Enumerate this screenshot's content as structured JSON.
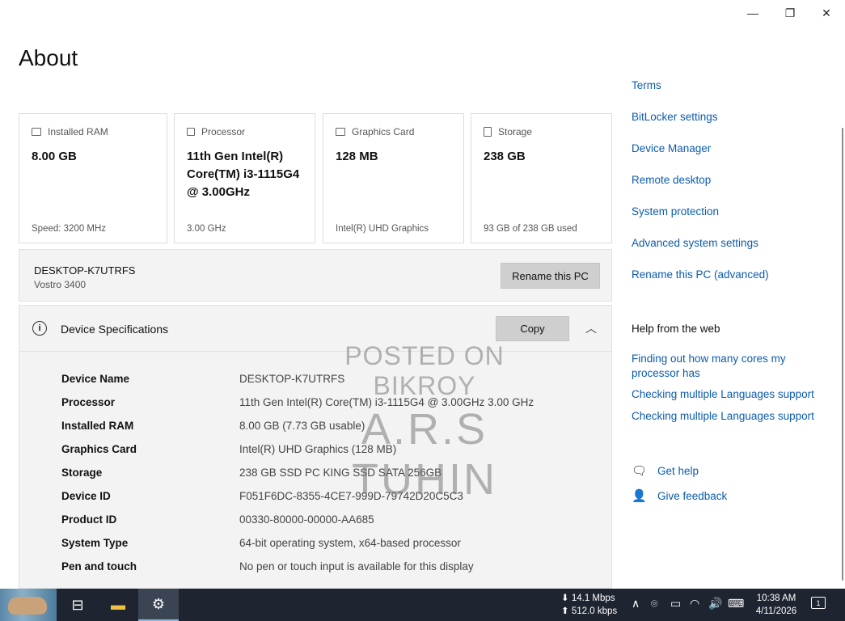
{
  "window": {
    "title": "About",
    "controls": {
      "minimize": "—",
      "restore": "❐",
      "close": "✕"
    }
  },
  "cards": [
    {
      "icon": "ram-icon",
      "label": "Installed RAM",
      "value": "8.00 GB",
      "footer": "Speed: 3200 MHz"
    },
    {
      "icon": "processor-icon",
      "label": "Processor",
      "value": "11th Gen Intel(R) Core(TM) i3-1115G4 @ 3.00GHz",
      "footer": "3.00 GHz"
    },
    {
      "icon": "graphics-card-icon",
      "label": "Graphics Card",
      "value": "128 MB",
      "footer": "Intel(R) UHD Graphics"
    },
    {
      "icon": "storage-icon",
      "label": "Storage",
      "value": "238 GB",
      "footer": "93 GB of 238 GB used"
    }
  ],
  "pc": {
    "name": "DESKTOP-K7UTRFS",
    "model": "Vostro 3400",
    "rename_button": "Rename this PC"
  },
  "specs": {
    "title": "Device Specifications",
    "copy_button": "Copy",
    "rows": [
      {
        "key": "Device Name",
        "value": "DESKTOP-K7UTRFS"
      },
      {
        "key": "Processor",
        "value": "11th Gen Intel(R) Core(TM) i3-1115G4 @ 3.00GHz   3.00 GHz"
      },
      {
        "key": "Installed RAM",
        "value": "8.00 GB (7.73 GB usable)"
      },
      {
        "key": "Graphics Card",
        "value": "Intel(R) UHD Graphics (128 MB)"
      },
      {
        "key": "Storage",
        "value": "238 GB SSD PC KING SSD SATA 256GB"
      },
      {
        "key": "Device ID",
        "value": "F051F6DC-8355-4CE7-999D-79742D20C5C3"
      },
      {
        "key": "Product ID",
        "value": "00330-80000-00000-AA685"
      },
      {
        "key": "System Type",
        "value": "64-bit operating system, x64-based processor"
      },
      {
        "key": "Pen and touch",
        "value": "No pen or touch input is available for this display"
      }
    ]
  },
  "related_links": [
    "Terms",
    "BitLocker settings",
    "Device Manager",
    "Remote desktop",
    "System protection",
    "Advanced system settings",
    "Rename this PC (advanced)"
  ],
  "help": {
    "title": "Help from the web",
    "links": [
      "Finding out how many cores my processor has",
      "Checking multiple Languages support",
      "Checking multiple Languages support"
    ],
    "get_help": "Get help",
    "give_feedback": "Give feedback"
  },
  "watermark": {
    "line1": "POSTED ON BIKROY",
    "line2": "A.R.S TUHIN"
  },
  "taskbar": {
    "net_down": "14.1 Mbps",
    "net_up": "512.0 kbps",
    "time": "10:38 AM",
    "date": "4/11/2026",
    "notifications": "1"
  },
  "colors": {
    "link": "#0b5cad",
    "taskbar": "#1f2530",
    "panel": "#f3f3f3"
  }
}
